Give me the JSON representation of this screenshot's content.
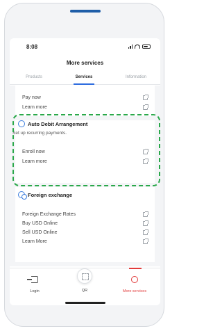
{
  "status": {
    "time": "8:08"
  },
  "header": {
    "title": "More services"
  },
  "tabs": [
    "Products",
    "Services",
    "Information"
  ],
  "payment": {
    "items": [
      "Pay now",
      "Learn more"
    ]
  },
  "auto_debit": {
    "title": "Auto Debit Arrangement",
    "subtitle": "Set up recurring payments.",
    "items": [
      "Enroll now",
      "Learn more"
    ]
  },
  "foreign_exchange": {
    "title": "Foreign exchange",
    "items": [
      "Foreign Exchange Rates",
      "Buy USD Online",
      "Sell USD Online",
      "Learn More"
    ]
  },
  "bottom_nav": {
    "login": "Login",
    "qr": "QR",
    "more": "More services"
  },
  "colors": {
    "accent": "#2d6cdf",
    "highlight_dash": "#2aa84a",
    "active_nav": "#e23b3b"
  }
}
